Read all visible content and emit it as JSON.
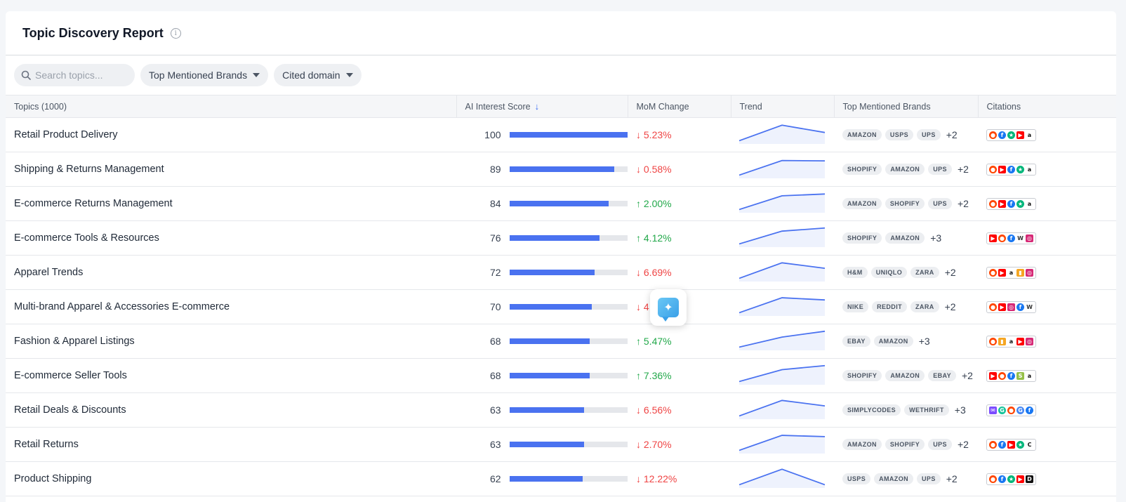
{
  "header": {
    "title": "Topic Discovery Report",
    "info_icon": "info-icon"
  },
  "toolbar": {
    "search_placeholder": "Search topics...",
    "filter_brands": "Top Mentioned Brands",
    "filter_domain": "Cited domain"
  },
  "columns": {
    "topics": "Topics (1000)",
    "score": "AI Interest Score",
    "mom": "MoM Change",
    "trend": "Trend",
    "brands": "Top Mentioned Brands",
    "citations": "Citations"
  },
  "colors": {
    "accent": "#4a72f0",
    "down": "#ef4444",
    "up": "#22a84a"
  },
  "rows": [
    {
      "topic": "Retail Product Delivery",
      "score": 100,
      "mom": "5.23%",
      "dir": "down",
      "trend": [
        0.1,
        0.95,
        0.55
      ],
      "brands": [
        "AMAZON",
        "USPS",
        "UPS"
      ],
      "more": "+2",
      "cites": [
        "reddit",
        "facebook",
        "trustpilot",
        "youtube",
        "amazon"
      ]
    },
    {
      "topic": "Shipping & Returns Management",
      "score": 89,
      "mom": "0.58%",
      "dir": "down",
      "trend": [
        0.1,
        0.9,
        0.88
      ],
      "brands": [
        "SHOPIFY",
        "AMAZON",
        "UPS"
      ],
      "more": "+2",
      "cites": [
        "reddit",
        "youtube",
        "facebook",
        "trustpilot",
        "amazon"
      ]
    },
    {
      "topic": "E-commerce Returns Management",
      "score": 84,
      "mom": "2.00%",
      "dir": "up",
      "trend": [
        0.1,
        0.85,
        0.95
      ],
      "brands": [
        "AMAZON",
        "SHOPIFY",
        "UPS"
      ],
      "more": "+2",
      "cites": [
        "reddit",
        "youtube",
        "facebook",
        "trustpilot",
        "amazon"
      ]
    },
    {
      "topic": "E-commerce Tools & Resources",
      "score": 76,
      "mom": "4.12%",
      "dir": "up",
      "trend": [
        0.1,
        0.8,
        0.97
      ],
      "brands": [
        "SHOPIFY",
        "AMAZON"
      ],
      "more": "+3",
      "cites": [
        "youtube",
        "reddit",
        "facebook",
        "wikipedia",
        "instagram"
      ]
    },
    {
      "topic": "Apparel Trends",
      "score": 72,
      "mom": "6.69%",
      "dir": "down",
      "trend": [
        0.1,
        0.95,
        0.65
      ],
      "brands": [
        "H&M",
        "UNIQLO",
        "ZARA"
      ],
      "more": "+2",
      "cites": [
        "reddit",
        "youtube",
        "amazon",
        "shop",
        "instagram"
      ]
    },
    {
      "topic": "Multi-brand Apparel & Accessories E-commerce",
      "score": 70,
      "mom": "4",
      "dir": "down",
      "trend": [
        0.1,
        0.92,
        0.8
      ],
      "brands": [
        "NIKE",
        "REDDIT",
        "ZARA"
      ],
      "more": "+2",
      "cites": [
        "reddit",
        "youtube",
        "instagram",
        "facebook",
        "wikipedia"
      ]
    },
    {
      "topic": "Fashion & Apparel Listings",
      "score": 68,
      "mom": "5.47%",
      "dir": "up",
      "trend": [
        0.1,
        0.65,
        0.97
      ],
      "brands": [
        "EBAY",
        "AMAZON"
      ],
      "more": "+3",
      "cites": [
        "reddit",
        "shop",
        "amazon",
        "youtube",
        "instagram"
      ]
    },
    {
      "topic": "E-commerce Seller Tools",
      "score": 68,
      "mom": "7.36%",
      "dir": "up",
      "trend": [
        0.1,
        0.75,
        0.97
      ],
      "brands": [
        "SHOPIFY",
        "AMAZON",
        "EBAY"
      ],
      "more": "+2",
      "cites": [
        "youtube",
        "reddit",
        "facebook",
        "shopify",
        "amazon"
      ]
    },
    {
      "topic": "Retail Deals & Discounts",
      "score": 63,
      "mom": "6.56%",
      "dir": "down",
      "trend": [
        0.1,
        0.95,
        0.65
      ],
      "brands": [
        "SIMPLYCODES",
        "WETHRIFT"
      ],
      "more": "+3",
      "cites": [
        "simplycodes",
        "grammarly",
        "reddit",
        "google",
        "facebook"
      ]
    },
    {
      "topic": "Retail Returns",
      "score": 63,
      "mom": "2.70%",
      "dir": "down",
      "trend": [
        0.1,
        0.92,
        0.85
      ],
      "brands": [
        "AMAZON",
        "SHOPIFY",
        "UPS"
      ],
      "more": "+2",
      "cites": [
        "reddit",
        "facebook",
        "youtube",
        "trustpilot",
        "c"
      ]
    },
    {
      "topic": "Product Shipping",
      "score": 62,
      "mom": "12.22%",
      "dir": "down",
      "trend": [
        0.1,
        0.95,
        0.1
      ],
      "brands": [
        "USPS",
        "AMAZON",
        "UPS"
      ],
      "more": "+2",
      "cites": [
        "reddit",
        "facebook",
        "trustpilot",
        "youtube",
        "d"
      ]
    }
  ]
}
